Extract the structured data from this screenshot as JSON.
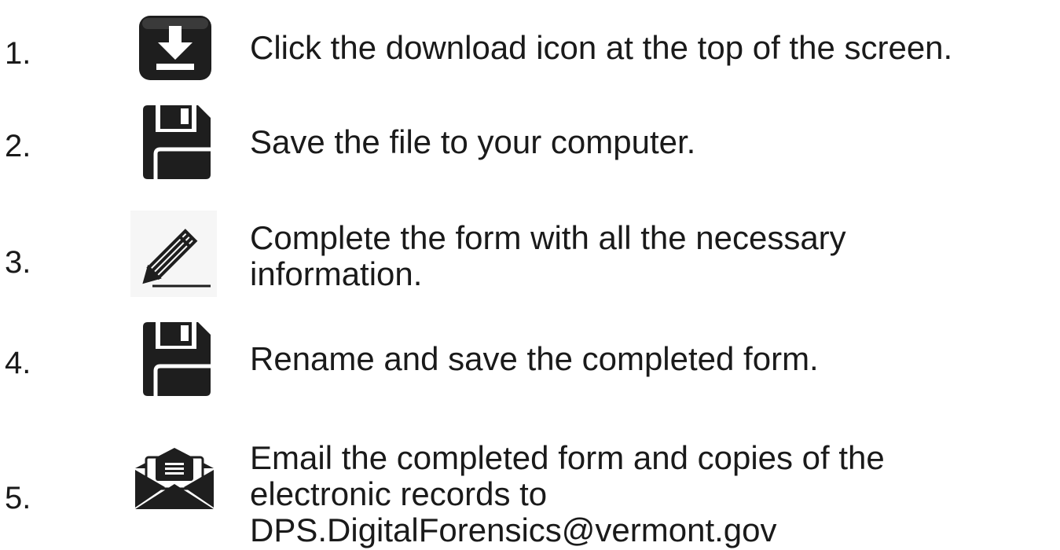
{
  "steps": [
    {
      "number": "1.",
      "icon": "download-icon",
      "lines": [
        "Click the download icon at the top of the screen."
      ]
    },
    {
      "number": "2.",
      "icon": "floppy-disk-icon",
      "lines": [
        "Save the file to your computer."
      ]
    },
    {
      "number": "3.",
      "icon": "pencil-icon",
      "lines": [
        "Complete the form with all the necessary",
        "information."
      ]
    },
    {
      "number": "4.",
      "icon": "floppy-disk-icon",
      "lines": [
        "Rename and save the completed form."
      ]
    },
    {
      "number": "5.",
      "icon": "envelope-icon",
      "lines": [
        "Email the completed form and copies of the",
        "electronic records to",
        "DPS.DigitalForensics@vermont.gov"
      ]
    }
  ]
}
